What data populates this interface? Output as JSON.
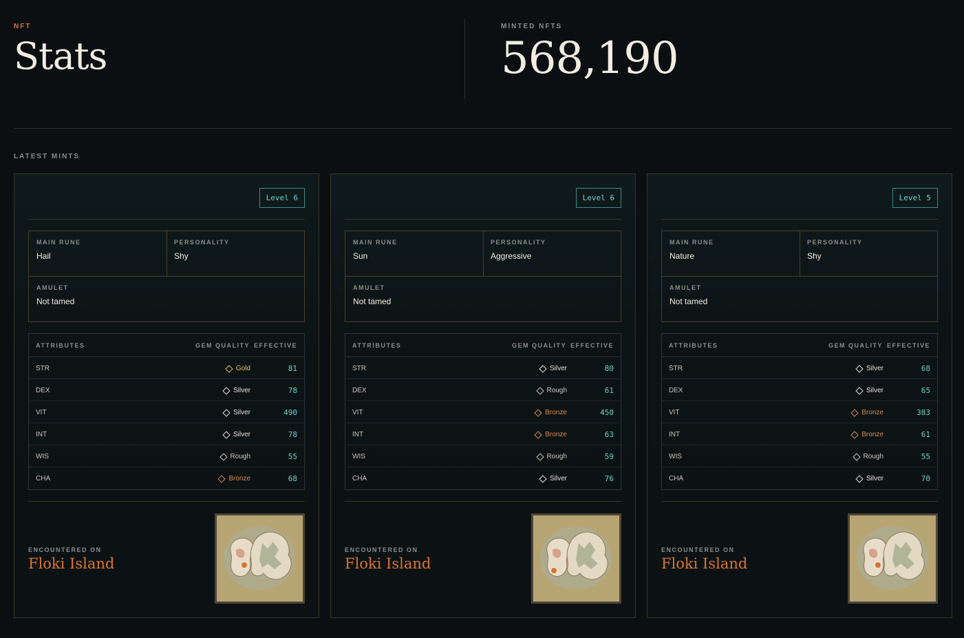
{
  "hero": {
    "eyebrow": "NFT",
    "title": "Stats",
    "count_label": "MINTED NFTS",
    "count": "568,190"
  },
  "section_label": "LATEST MINTS",
  "labels": {
    "main_rune": "MAIN RUNE",
    "personality": "PERSONALITY",
    "amulet": "AMULET",
    "attributes": "ATTRIBUTES",
    "gem_quality": "GEM QUALITY",
    "effective": "EFFECTIVE",
    "encountered_on": "ENCOUNTERED ON"
  },
  "cards": [
    {
      "level": "Level 6",
      "main_rune": "Hail",
      "personality": "Shy",
      "amulet": "Not tamed",
      "attributes": [
        {
          "name": "STR",
          "gem": "Gold",
          "effective": "81"
        },
        {
          "name": "DEX",
          "gem": "Silver",
          "effective": "78"
        },
        {
          "name": "VIT",
          "gem": "Silver",
          "effective": "490"
        },
        {
          "name": "INT",
          "gem": "Silver",
          "effective": "78"
        },
        {
          "name": "WIS",
          "gem": "Rough",
          "effective": "55"
        },
        {
          "name": "CHA",
          "gem": "Bronze",
          "effective": "68"
        }
      ],
      "location": "Floki Island"
    },
    {
      "level": "Level 6",
      "main_rune": "Sun",
      "personality": "Aggressive",
      "amulet": "Not tamed",
      "attributes": [
        {
          "name": "STR",
          "gem": "Silver",
          "effective": "80"
        },
        {
          "name": "DEX",
          "gem": "Rough",
          "effective": "61"
        },
        {
          "name": "VIT",
          "gem": "Bronze",
          "effective": "450"
        },
        {
          "name": "INT",
          "gem": "Bronze",
          "effective": "63"
        },
        {
          "name": "WIS",
          "gem": "Rough",
          "effective": "59"
        },
        {
          "name": "CHA",
          "gem": "Silver",
          "effective": "76"
        }
      ],
      "location": "Floki Island"
    },
    {
      "level": "Level 5",
      "main_rune": "Nature",
      "personality": "Shy",
      "amulet": "Not tamed",
      "attributes": [
        {
          "name": "STR",
          "gem": "Silver",
          "effective": "68"
        },
        {
          "name": "DEX",
          "gem": "Silver",
          "effective": "65"
        },
        {
          "name": "VIT",
          "gem": "Bronze",
          "effective": "383"
        },
        {
          "name": "INT",
          "gem": "Bronze",
          "effective": "61"
        },
        {
          "name": "WIS",
          "gem": "Rough",
          "effective": "55"
        },
        {
          "name": "CHA",
          "gem": "Silver",
          "effective": "70"
        }
      ],
      "location": "Floki Island"
    }
  ],
  "colors": {
    "accent_orange": "#d9742f",
    "accent_teal": "#6ed0c6",
    "gold": "#e5c25b",
    "bronze": "#d98a4a",
    "silver": "#e6e3da"
  }
}
